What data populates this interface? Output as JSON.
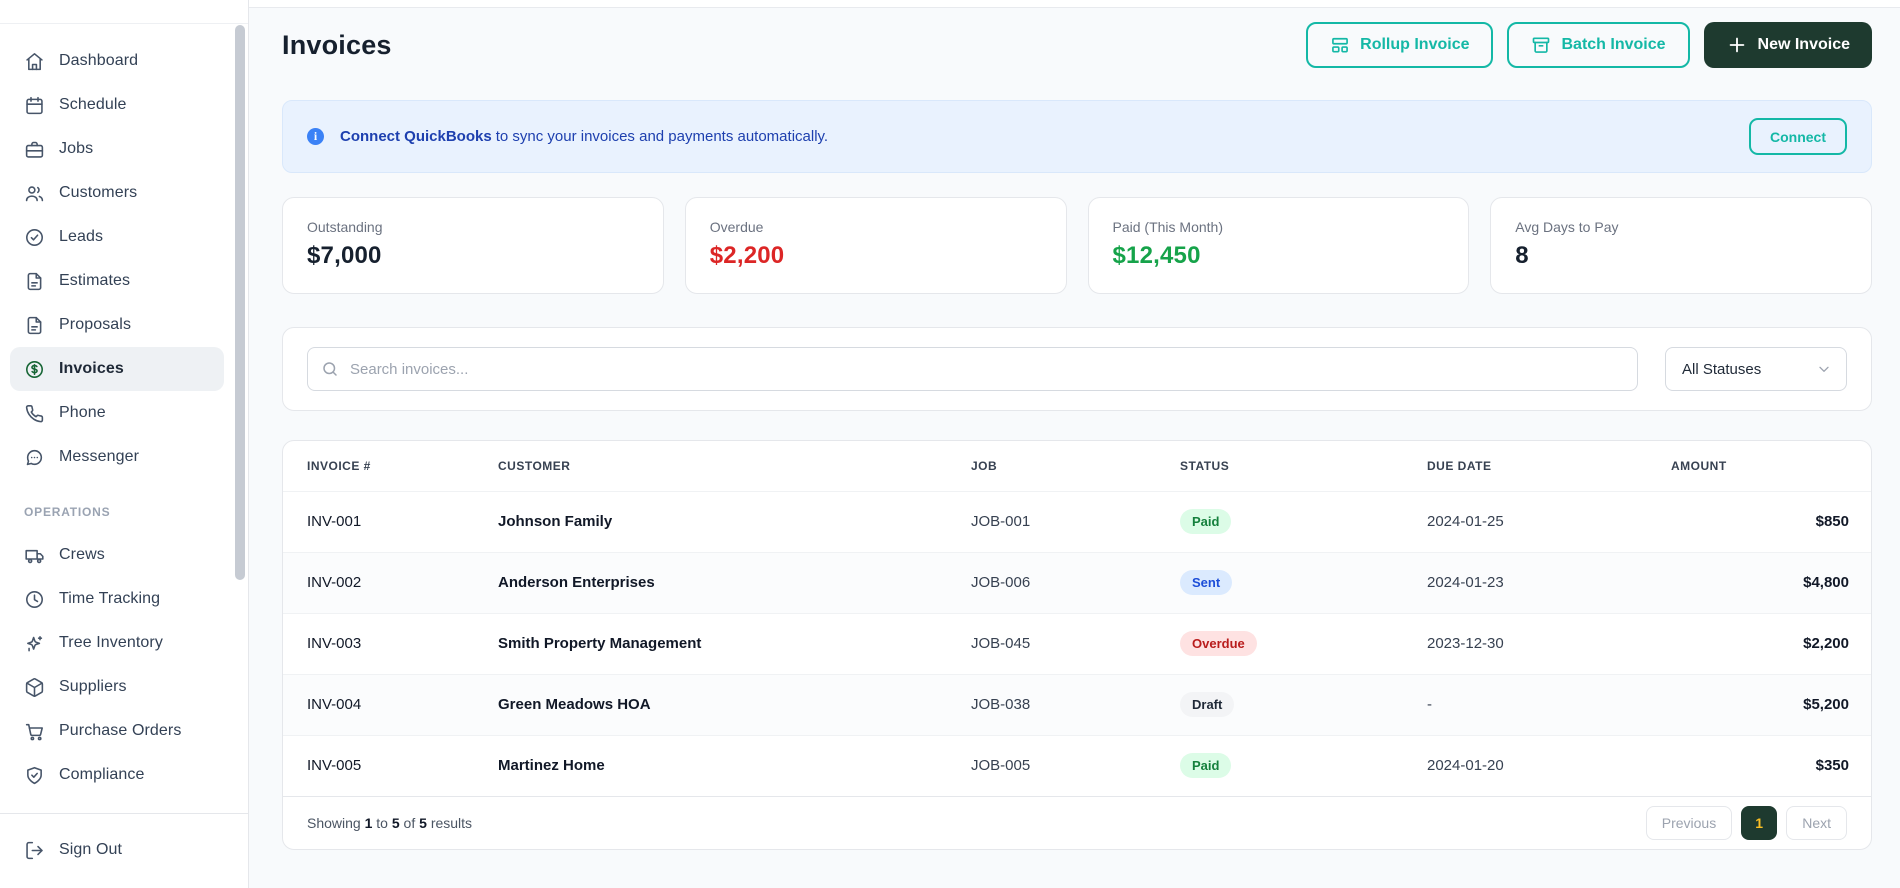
{
  "sidebar": {
    "main_items": [
      {
        "label": "Dashboard",
        "icon": "home-icon",
        "active": false
      },
      {
        "label": "Schedule",
        "icon": "calendar-icon",
        "active": false
      },
      {
        "label": "Jobs",
        "icon": "briefcase-icon",
        "active": false
      },
      {
        "label": "Customers",
        "icon": "customers-icon",
        "active": false
      },
      {
        "label": "Leads",
        "icon": "leads-check-icon",
        "active": false
      },
      {
        "label": "Estimates",
        "icon": "document-icon",
        "active": false
      },
      {
        "label": "Proposals",
        "icon": "document-icon",
        "active": false
      },
      {
        "label": "Invoices",
        "icon": "dollar-circle-icon",
        "active": true
      },
      {
        "label": "Phone",
        "icon": "phone-icon",
        "active": false
      },
      {
        "label": "Messenger",
        "icon": "chat-bubble-icon",
        "active": false
      }
    ],
    "section_label": "OPERATIONS",
    "operations_items": [
      {
        "label": "Crews",
        "icon": "truck-icon",
        "active": false
      },
      {
        "label": "Time Tracking",
        "icon": "clock-icon",
        "active": false
      },
      {
        "label": "Tree Inventory",
        "icon": "sparkles-icon",
        "active": false
      },
      {
        "label": "Suppliers",
        "icon": "package-icon",
        "active": false
      },
      {
        "label": "Purchase Orders",
        "icon": "cart-icon",
        "active": false
      },
      {
        "label": "Compliance",
        "icon": "shield-check-icon",
        "active": false
      }
    ],
    "sign_out": {
      "label": "Sign Out",
      "icon": "logout-icon"
    }
  },
  "header": {
    "title": "Invoices",
    "rollup_button": "Rollup Invoice",
    "batch_button": "Batch Invoice",
    "new_button": "New Invoice"
  },
  "banner": {
    "bold_text": "Connect QuickBooks",
    "rest_text": "to sync your invoices and payments automatically.",
    "connect_button": "Connect"
  },
  "stats": [
    {
      "label": "Outstanding",
      "value": "$7,000",
      "value_color": "#16202e"
    },
    {
      "label": "Overdue",
      "value": "$2,200",
      "value_color": "#dc2626"
    },
    {
      "label": "Paid (This Month)",
      "value": "$12,450",
      "value_color": "#16a34a"
    },
    {
      "label": "Avg Days to Pay",
      "value": "8",
      "value_color": "#16202e"
    }
  ],
  "filters": {
    "search_placeholder": "Search invoices...",
    "status_filter": "All Statuses"
  },
  "table": {
    "columns": [
      "INVOICE #",
      "CUSTOMER",
      "JOB",
      "STATUS",
      "DUE DATE",
      "AMOUNT"
    ],
    "rows": [
      {
        "invoice": "INV-001",
        "customer": "Johnson Family",
        "job": "JOB-001",
        "status": "Paid",
        "due_date": "2024-01-25",
        "amount": "$850"
      },
      {
        "invoice": "INV-002",
        "customer": "Anderson Enterprises",
        "job": "JOB-006",
        "status": "Sent",
        "due_date": "2024-01-23",
        "amount": "$4,800"
      },
      {
        "invoice": "INV-003",
        "customer": "Smith Property Management",
        "job": "JOB-045",
        "status": "Overdue",
        "due_date": "2023-12-30",
        "amount": "$2,200"
      },
      {
        "invoice": "INV-004",
        "customer": "Green Meadows HOA",
        "job": "JOB-038",
        "status": "Draft",
        "due_date": "-",
        "amount": "$5,200"
      },
      {
        "invoice": "INV-005",
        "customer": "Martinez Home",
        "job": "JOB-005",
        "status": "Paid",
        "due_date": "2024-01-20",
        "amount": "$350"
      }
    ]
  },
  "pagination": {
    "prefix": "Showing",
    "from": "1",
    "to_word": "to",
    "to": "5",
    "of_word": "of",
    "total": "5",
    "suffix": "results",
    "previous_label": "Previous",
    "current_page": "1",
    "next_label": "Next"
  },
  "colors": {
    "accent_teal": "#14b8a6",
    "dark_green": "#1e3a2f",
    "current_page_text": "#fbbf24",
    "overdue_red": "#dc2626",
    "paid_green": "#16a34a",
    "banner_bg": "#e9f2fe",
    "banner_text": "#1e40af",
    "info_icon_blue": "#3b82f6",
    "paid_badge_bg": "#dcfce7",
    "paid_badge_text": "#15803d",
    "sent_badge_bg": "#dbeafe",
    "sent_badge_text": "#1d4ed8",
    "overdue_badge_bg": "#fee2e2",
    "overdue_badge_text": "#b91c1c",
    "draft_badge_bg": "#f3f4f6",
    "draft_badge_text": "#1f2937"
  }
}
